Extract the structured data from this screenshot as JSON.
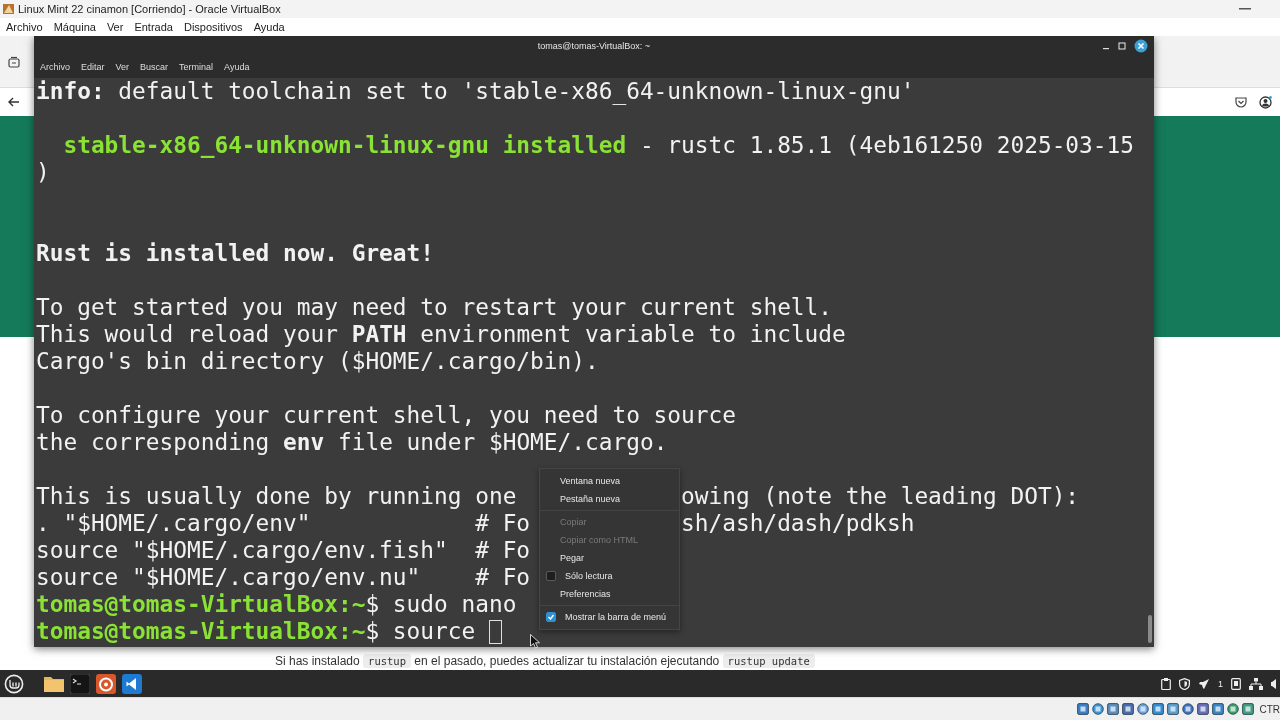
{
  "window": {
    "title": "Linux Mint 22 cinamon [Corriendo] - Oracle VirtualBox"
  },
  "menu_bar": [
    "Archivo",
    "Máquina",
    "Ver",
    "Entrada",
    "Dispositivos",
    "Ayuda"
  ],
  "browser": {
    "page_text": [
      {
        "kind": "text",
        "text": "Si has instalado"
      },
      {
        "kind": "code",
        "text": "rustup"
      },
      {
        "kind": "text",
        "text": "en el pasado, puedes actualizar tu instalación ejecutando"
      },
      {
        "kind": "code",
        "text": "rustup update"
      }
    ]
  },
  "terminal": {
    "title": "tomas@tomas-VirtualBox: ~",
    "menu": [
      "Archivo",
      "Editar",
      "Ver",
      "Buscar",
      "Terminal",
      "Ayuda"
    ],
    "lines": [
      {
        "kind": "text",
        "segments": [
          {
            "kind": "bold",
            "text": "info:"
          },
          {
            "kind": "plain",
            "text": " default toolchain set to 'stable-x86_64-unknown-linux-gnu'"
          }
        ]
      },
      {
        "kind": "blank"
      },
      {
        "kind": "text",
        "segments": [
          {
            "kind": "green",
            "text": "  stable-x86_64-unknown-linux-gnu installed"
          },
          {
            "kind": "plain",
            "text": " - rustc 1.85.1 (4eb161250 2025-03-15"
          }
        ]
      },
      {
        "kind": "text",
        "segments": [
          {
            "kind": "plain",
            "text": ")"
          }
        ]
      },
      {
        "kind": "blank"
      },
      {
        "kind": "blank"
      },
      {
        "kind": "text",
        "segments": [
          {
            "kind": "bold",
            "text": "Rust is installed now. Great!"
          }
        ]
      },
      {
        "kind": "blank"
      },
      {
        "kind": "text",
        "segments": [
          {
            "kind": "plain",
            "text": "To get started you may need to restart your current shell."
          }
        ]
      },
      {
        "kind": "text",
        "segments": [
          {
            "kind": "plain",
            "text": "This would reload your "
          },
          {
            "kind": "bold",
            "text": "PATH"
          },
          {
            "kind": "plain",
            "text": " environment variable to include"
          }
        ]
      },
      {
        "kind": "text",
        "segments": [
          {
            "kind": "plain",
            "text": "Cargo's bin directory ($HOME/.cargo/bin)."
          }
        ]
      },
      {
        "kind": "blank"
      },
      {
        "kind": "text",
        "segments": [
          {
            "kind": "plain",
            "text": "To configure your current shell, you need to source"
          }
        ]
      },
      {
        "kind": "text",
        "segments": [
          {
            "kind": "plain",
            "text": "the corresponding "
          },
          {
            "kind": "bold",
            "text": "env"
          },
          {
            "kind": "plain",
            "text": " file under $HOME/.cargo."
          }
        ]
      },
      {
        "kind": "blank"
      },
      {
        "kind": "text",
        "segments": [
          {
            "kind": "plain",
            "text": "This is usually done by running one"
          }
        ],
        "right": "owing (note the leading DOT):"
      },
      {
        "kind": "text",
        "segments": [
          {
            "kind": "plain",
            "text": ". \"$HOME/.cargo/env\"            # Fo"
          }
        ],
        "right": "sh/ash/dash/pdksh"
      },
      {
        "kind": "text",
        "segments": [
          {
            "kind": "plain",
            "text": "source \"$HOME/.cargo/env.fish\"  # Fo"
          }
        ]
      },
      {
        "kind": "text",
        "segments": [
          {
            "kind": "plain",
            "text": "source \"$HOME/.cargo/env.nu\"    # Fo"
          }
        ]
      },
      {
        "kind": "text",
        "segments": [
          {
            "kind": "prompt",
            "text": "tomas@tomas-VirtualBox:~"
          },
          {
            "kind": "plain",
            "text": "$ sudo nano"
          }
        ]
      },
      {
        "kind": "text",
        "segments": [
          {
            "kind": "prompt",
            "text": "tomas@tomas-VirtualBox:~"
          },
          {
            "kind": "plain",
            "text": "$ source "
          }
        ],
        "cursor": true
      }
    ],
    "context_menu": {
      "items": [
        {
          "kind": "item",
          "label": "Ventana nueva",
          "disabled": false
        },
        {
          "kind": "item",
          "label": "Pestaña nueva",
          "disabled": false
        },
        {
          "kind": "separator"
        },
        {
          "kind": "item",
          "label": "Copiar",
          "disabled": true
        },
        {
          "kind": "item",
          "label": "Copiar como HTML",
          "disabled": true
        },
        {
          "kind": "item",
          "label": "Pegar",
          "disabled": false
        },
        {
          "kind": "check",
          "label": "Sólo lectura",
          "checked": false
        },
        {
          "kind": "item",
          "label": "Preferencias",
          "disabled": false
        },
        {
          "kind": "separator"
        },
        {
          "kind": "check",
          "label": "Mostrar la barra de menú",
          "checked": true
        }
      ]
    }
  },
  "taskbar": {
    "tray_count": "1"
  },
  "status_bar": {
    "host_key": "CTR"
  }
}
